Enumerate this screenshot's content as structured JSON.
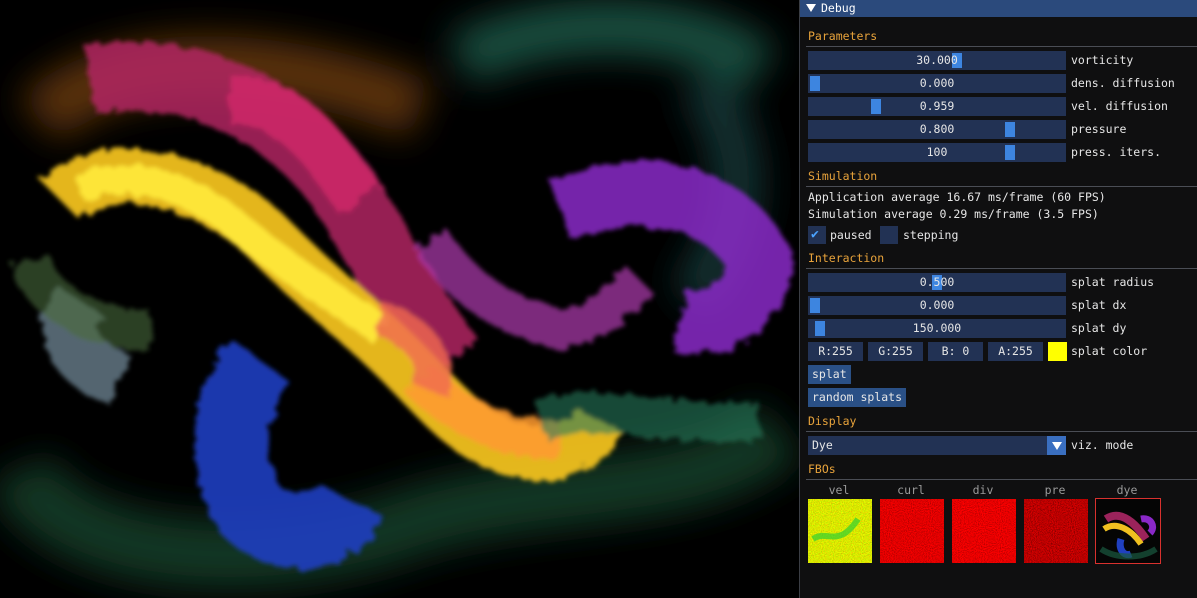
{
  "window": {
    "title": "Debug"
  },
  "sections": {
    "parameters": "Parameters",
    "simulation": "Simulation",
    "interaction": "Interaction",
    "display": "Display",
    "fbos": "FBOs"
  },
  "parameters": [
    {
      "value": "30.000",
      "label": "vorticity",
      "fraction": 0.58
    },
    {
      "value": "0.000",
      "label": "dens. diffusion",
      "fraction": 0.0
    },
    {
      "value": "0.959",
      "label": "vel. diffusion",
      "fraction": 0.25
    },
    {
      "value": "0.800",
      "label": "pressure",
      "fraction": 0.8
    },
    {
      "value": "100",
      "label": "press. iters.",
      "fraction": 0.8
    }
  ],
  "simulation": {
    "app_average": "Application average 16.67 ms/frame (60 FPS)",
    "sim_average": "Simulation average 0.29 ms/frame (3.5 FPS)",
    "paused_label": "paused",
    "paused": true,
    "stepping_label": "stepping",
    "stepping": false
  },
  "interaction": {
    "sliders": [
      {
        "value": "0.500",
        "label": "splat radius",
        "fraction": 0.5
      },
      {
        "value": "0.000",
        "label": "splat dx",
        "fraction": 0.0
      },
      {
        "value": "150.000",
        "label": "splat dy",
        "fraction": 0.02
      }
    ],
    "color": {
      "r": "R:255",
      "g": "G:255",
      "b": "B:  0",
      "a": "A:255",
      "label": "splat color",
      "hex": "#ffff00"
    },
    "splat_button": "splat",
    "random_button": "random splats"
  },
  "display": {
    "mode_value": "Dye",
    "mode_label": "viz. mode"
  },
  "fbos": [
    {
      "label": "vel",
      "selected": false
    },
    {
      "label": "curl",
      "selected": false
    },
    {
      "label": "div",
      "selected": false
    },
    {
      "label": "pre",
      "selected": false
    },
    {
      "label": "dye",
      "selected": true
    }
  ],
  "colors": {
    "accent": "#3d85e0",
    "section_header": "#e8a33b",
    "title_bar": "#2b4a7c",
    "frame_bg": "#223254",
    "button": "#2a5086",
    "fbo_selected_border": "#d8312e"
  }
}
